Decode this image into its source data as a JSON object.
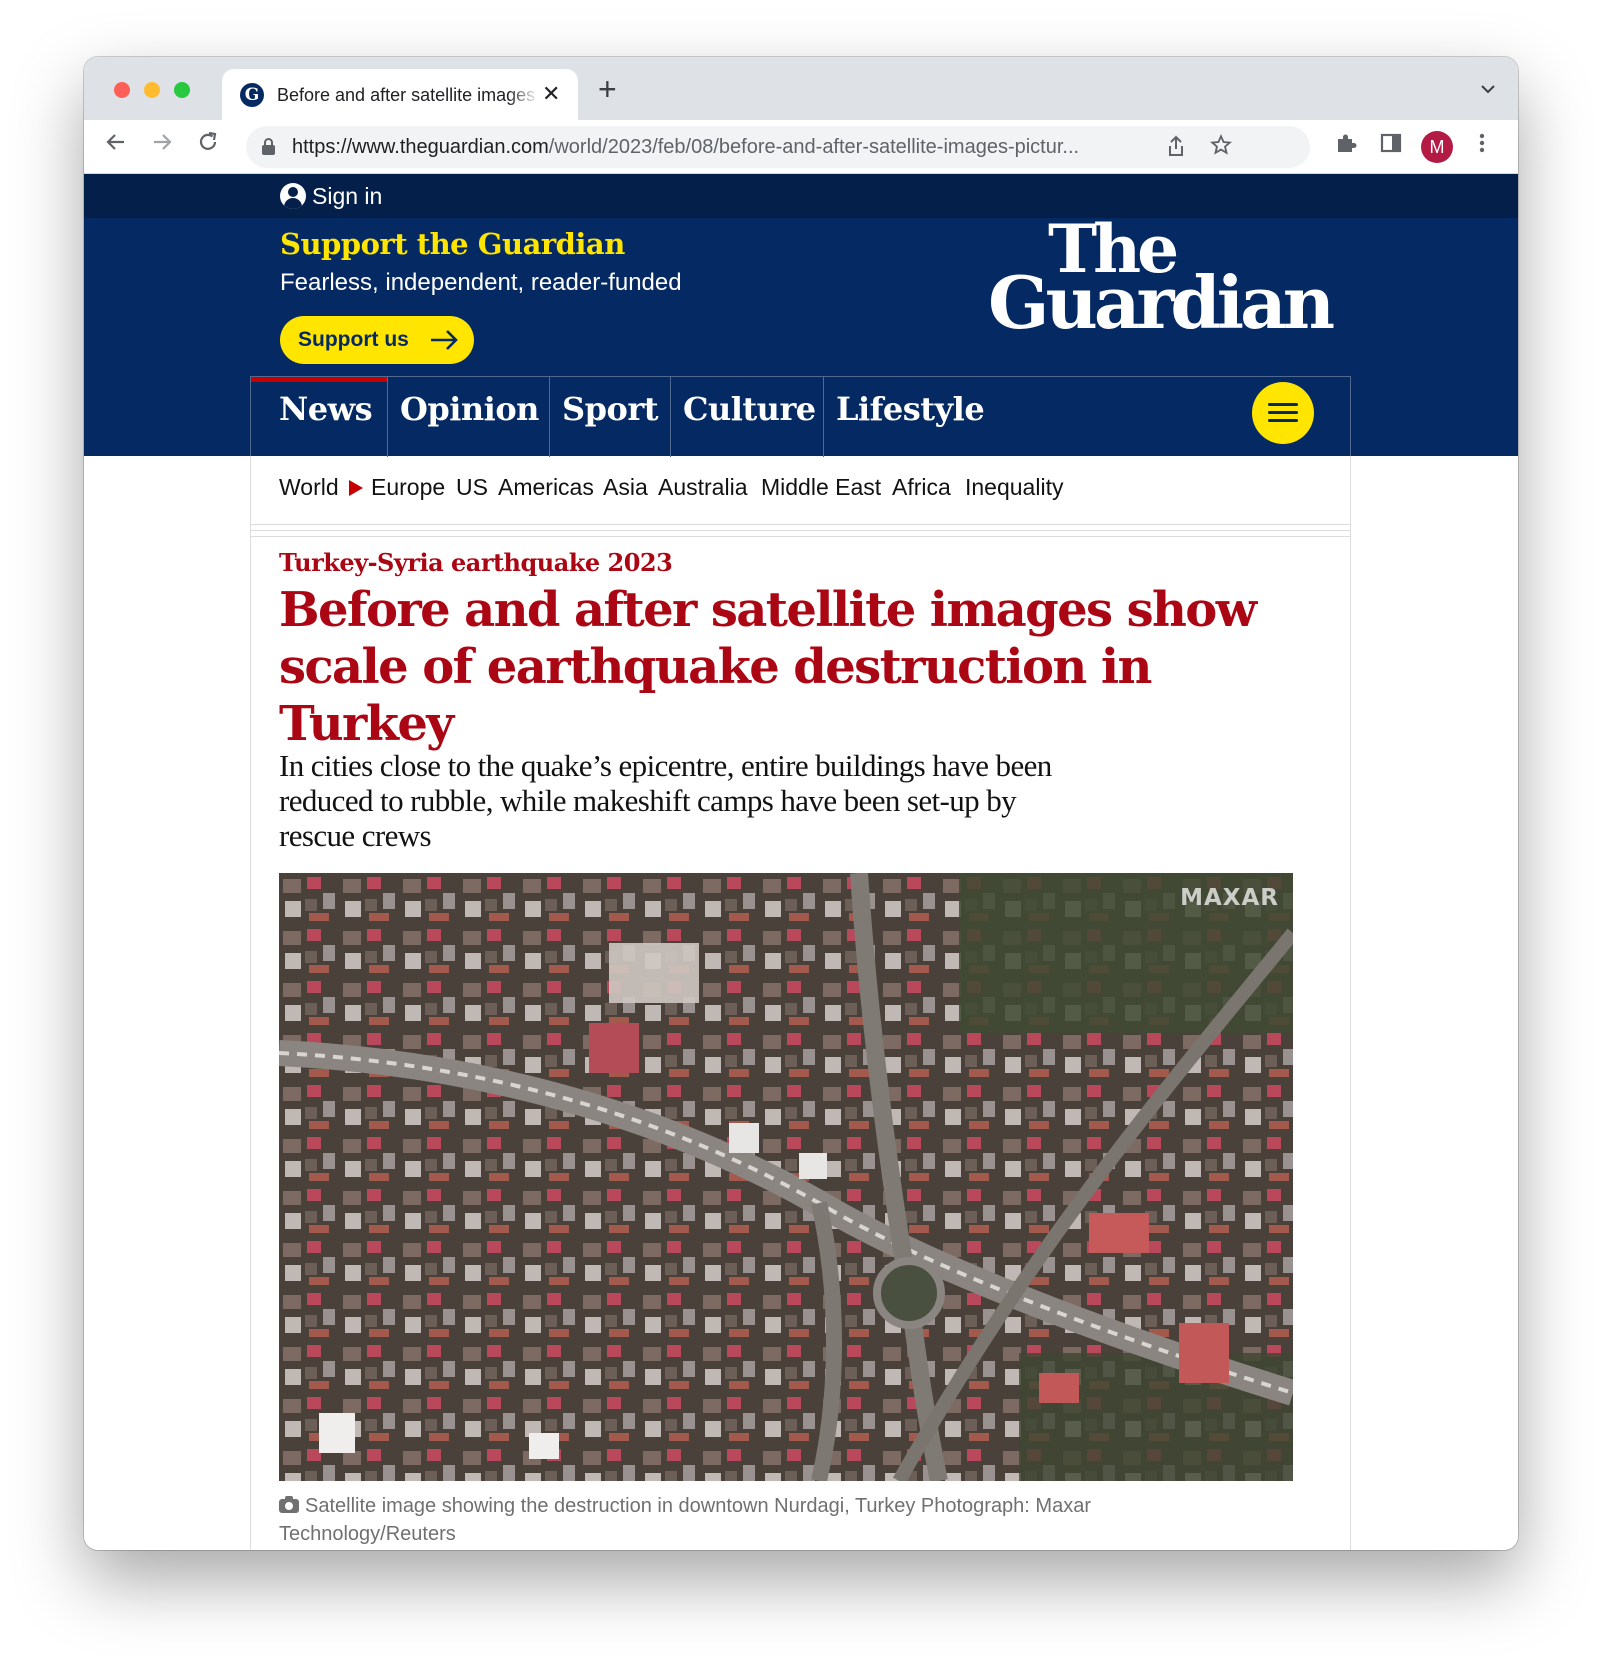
{
  "browser": {
    "tab_title": "Before and after satellite images show scale of earthquake destruction in Turkey",
    "tab_close": "✕",
    "new_tab": "+",
    "url_host": "https://www.theguardian.com",
    "url_path": "/world/2023/feb/08/before-and-after-satellite-images-pictur...",
    "profile_initial": "M",
    "icons": {
      "back": "back-arrow-icon",
      "forward": "forward-arrow-icon",
      "reload": "reload-icon",
      "lock": "lock-icon",
      "share": "share-icon",
      "bookmark": "star-icon",
      "extensions": "puzzle-icon",
      "side_panel": "side-panel-icon",
      "menu": "kebab-menu-icon"
    }
  },
  "header": {
    "sign_in": "Sign in",
    "support_title": "Support the Guardian",
    "support_subtitle": "Fearless, independent, reader-funded",
    "support_button": "Support us",
    "logo_line1": "The",
    "logo_line2": "Guardian",
    "colors": {
      "brand": "#052962",
      "top_bar": "#041f4a",
      "accent_yellow": "#ffe500",
      "news_red": "#c70000"
    }
  },
  "nav": {
    "pillars": [
      "News",
      "Opinion",
      "Sport",
      "Culture",
      "Lifestyle"
    ],
    "active_pillar": "News"
  },
  "subnav": {
    "items": [
      "World",
      "Europe",
      "US",
      "Americas",
      "Asia",
      "Australia",
      "Middle East",
      "Africa",
      "Inequality"
    ]
  },
  "article": {
    "kicker": "Turkey-Syria earthquake 2023",
    "headline": "Before and after satellite images show scale of earthquake destruction in Turkey",
    "standfirst": "In cities close to the quake’s epicentre, entire buildings have been reduced to rubble, while makeshift camps have been set-up by rescue crews",
    "image_watermark": "MAXAR",
    "caption": "Satellite image showing the destruction in downtown Nurdagi, Turkey Photograph: Maxar Technology/Reuters"
  }
}
